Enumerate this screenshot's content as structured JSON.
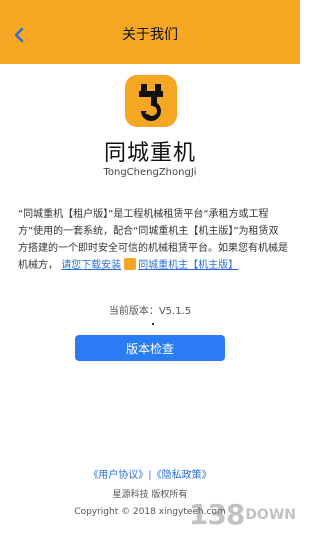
{
  "header": {
    "title": "关于我们",
    "back_icon": "chevron-left-icon"
  },
  "app": {
    "icon": "crane-hook-icon",
    "name": "同城重机",
    "name_latin": "TongChengZhongJi"
  },
  "description": {
    "text_before_link": "“同城重机【租户版】”是工程机械租赁平台“承租方或工程方”使用的一套系统，配合“同城重机主【机主版】”为租赁双方搭建的一个即时安全可信的机械租赁平台。如果您有机械是机械方，",
    "link_text_prefix": "请您下载安装",
    "link_text_suffix": "同城重机主【机主版】"
  },
  "version": {
    "text": "当前版本：V5.1.5"
  },
  "buttons": {
    "check_update": "版本检查"
  },
  "footer": {
    "policy_text": "《用户协议》|《隐私政策》",
    "company": "星源科技 版权所有",
    "copyright": "Copyright © 2018 xingyteeh.com"
  },
  "watermark": {
    "big": "138",
    "small": "DOWN"
  },
  "colors": {
    "accent": "#f5a623",
    "button": "#2a7cf4",
    "link": "#2a6fd6"
  }
}
